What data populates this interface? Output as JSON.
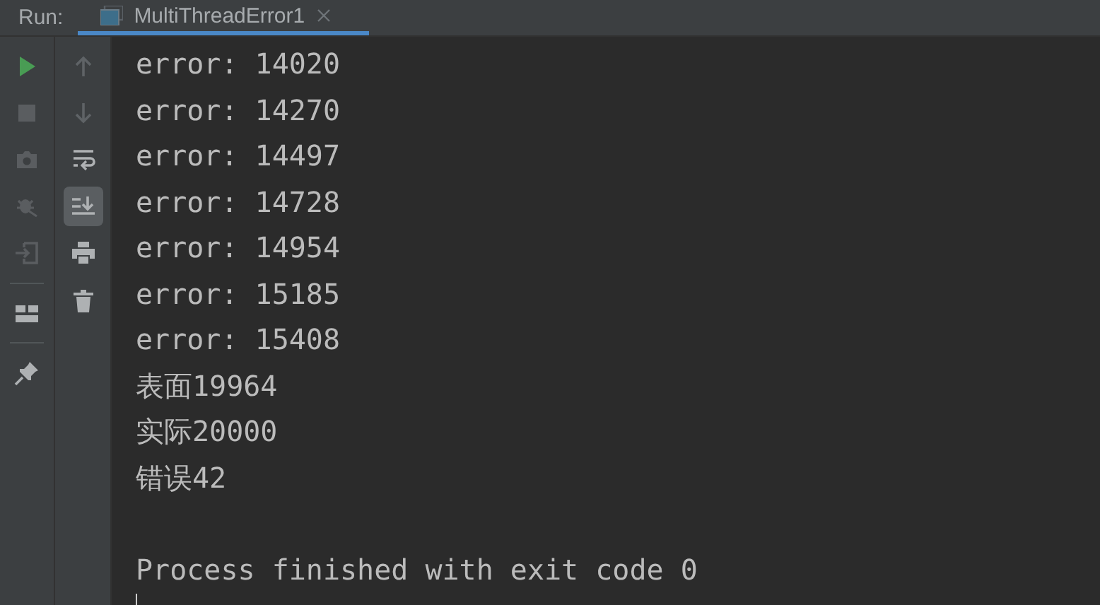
{
  "header": {
    "label": "Run:",
    "tab": {
      "title": "MultiThreadError1",
      "selected": true
    }
  },
  "left_tools": [
    {
      "kind": "run",
      "disabled": false
    },
    {
      "kind": "stop",
      "disabled": true
    },
    {
      "kind": "camera",
      "disabled": true
    },
    {
      "kind": "bug",
      "disabled": true
    },
    {
      "kind": "exit",
      "disabled": true
    },
    {
      "kind": "divider"
    },
    {
      "kind": "layout",
      "disabled": false
    },
    {
      "kind": "divider"
    },
    {
      "kind": "pin",
      "disabled": false
    }
  ],
  "right_tools": [
    {
      "kind": "up",
      "selected": false
    },
    {
      "kind": "down",
      "selected": false
    },
    {
      "kind": "wrap",
      "selected": false
    },
    {
      "kind": "scroll-end",
      "selected": true
    },
    {
      "kind": "print",
      "selected": false
    },
    {
      "kind": "trash",
      "selected": false
    }
  ],
  "output": [
    "error: 14020",
    "error: 14270",
    "error: 14497",
    "error: 14728",
    "error: 14954",
    "error: 15185",
    "error: 15408",
    "表面19964",
    "实际20000",
    "错误42"
  ],
  "exit_message": "Process finished with exit code 0"
}
